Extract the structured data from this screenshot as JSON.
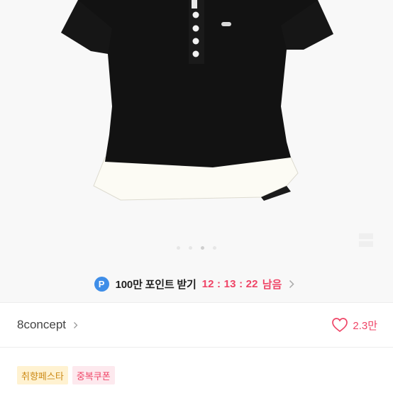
{
  "product": {
    "image_count": 4,
    "active_image_index": 2
  },
  "point_banner": {
    "badge": "P",
    "text": "100만 포인트 받기",
    "timer": "12 : 13 : 22",
    "suffix": "남음",
    "icon": "chevron-right-icon"
  },
  "shop": {
    "name": "8concept",
    "chevron_icon": "chevron-right-icon",
    "like_icon": "heart-outline-icon",
    "likes": "2.3만"
  },
  "tags": [
    {
      "label": "취향페스타",
      "style": "yellow"
    },
    {
      "label": "중복쿠폰",
      "style": "pink"
    }
  ],
  "colors": {
    "accent": "#ef4466",
    "point_badge": "#3f8ee8",
    "tag_yellow_bg": "#fff2d1",
    "tag_yellow_text": "#cc8a16",
    "tag_pink_bg": "#fde9ee"
  }
}
